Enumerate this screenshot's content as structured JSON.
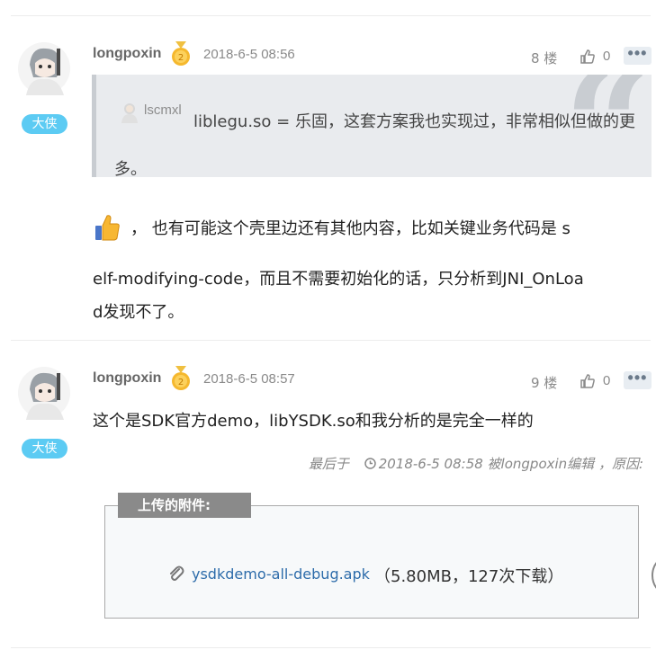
{
  "posts": [
    {
      "username": "longpoxin",
      "rank": "大侠",
      "time": "2018-6-5 08:56",
      "floor": "8 楼",
      "likes": "0",
      "more": "•••",
      "quote": {
        "user": "lscmxl",
        "text": "liblegu.so = 乐固，这套方案我也实现过，非常相似但做的更多。"
      },
      "body_line1": "，  也有可能这个壳里边还有其他内容，比如关键业务代码是 s",
      "body_line2": "elf-modifying-code，而且不需要初始化的话，只分析到JNI_OnLoa",
      "body_line3": "d发现不了。"
    },
    {
      "username": "longpoxin",
      "rank": "大侠",
      "time": "2018-6-5 08:57",
      "floor": "9 楼",
      "likes": "0",
      "more": "•••",
      "body_line1": "这个是SDK官方demo，libYSDK.so和我分析的是完全一样的",
      "edit_prefix": "最后于",
      "edit_suffix": "2018-6-5 08:58 被longpoxin编辑 ，原因:",
      "attachment": {
        "title": "上传的附件:",
        "filename": "ysdkdemo-all-debug.apk",
        "meta": "（5.80MB，127次下载）"
      }
    }
  ],
  "icons": {
    "medal": "medal-icon",
    "like": "thumbs-up-icon",
    "more": "more-dots-icon",
    "clock": "clock-icon",
    "clip": "paperclip-icon",
    "emoji": "thumbs-up-emoji"
  },
  "colors": {
    "rank_badge": "#5ccbf3",
    "link": "#2d6caa",
    "attach_header": "#8a8a8a"
  }
}
